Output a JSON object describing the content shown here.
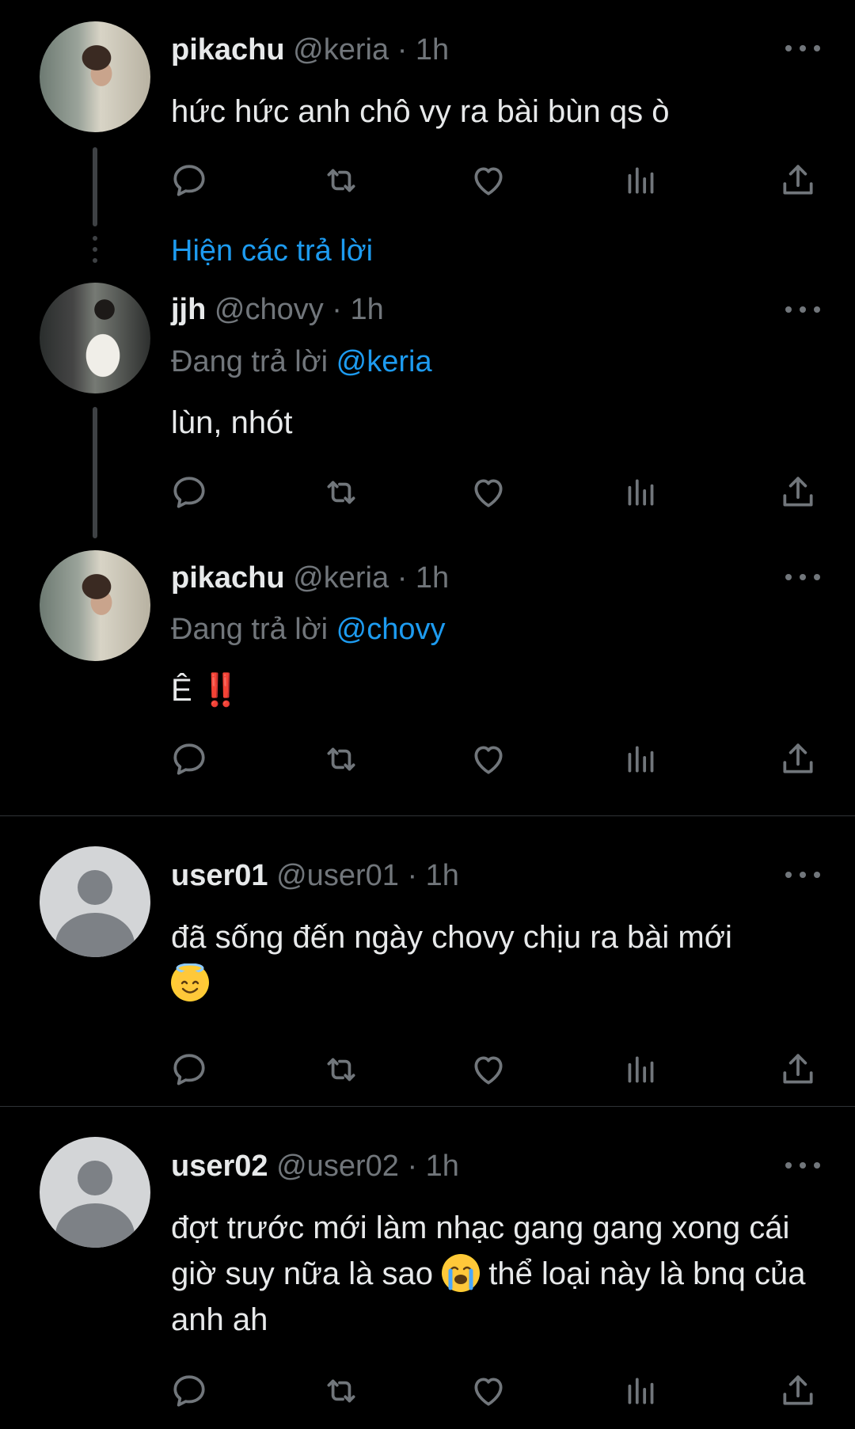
{
  "posts": [
    {
      "name": "pikachu",
      "handle": "@keria",
      "time": "· 1h",
      "text": "hức hức anh chô vy ra bài bùn qs ò"
    },
    {
      "name": "jjh",
      "handle": "@chovy",
      "time": "· 1h",
      "replying_prefix": "Đang trả lời",
      "replying_to": "@keria",
      "text": "lùn, nhót"
    },
    {
      "name": "pikachu",
      "handle": "@keria",
      "time": "· 1h",
      "replying_prefix": "Đang trả lời",
      "replying_to": "@chovy",
      "text": "Ê",
      "text_emoji": "‼️"
    },
    {
      "name": "user01",
      "handle": "@user01",
      "time": "· 1h",
      "text": "đã sống đến ngày chovy chịu ra bài mới"
    },
    {
      "name": "user02",
      "handle": "@user02",
      "time": "· 1h",
      "text_part1": "đợt trước mới làm nhạc gang gang xong cái giờ suy nữa là sao",
      "text_part2": "thể loại này là bnq của anh ah"
    }
  ],
  "show_replies": "Hiện các trả lời",
  "icons": {
    "reply": "reply-icon",
    "repost": "repost-icon",
    "like": "heart-icon",
    "views": "views-icon",
    "share": "share-icon",
    "more": "more-icon"
  },
  "colors": {
    "background": "#000000",
    "accent": "#1d9bf0",
    "muted": "#71767b",
    "text": "#e7e9ea"
  }
}
